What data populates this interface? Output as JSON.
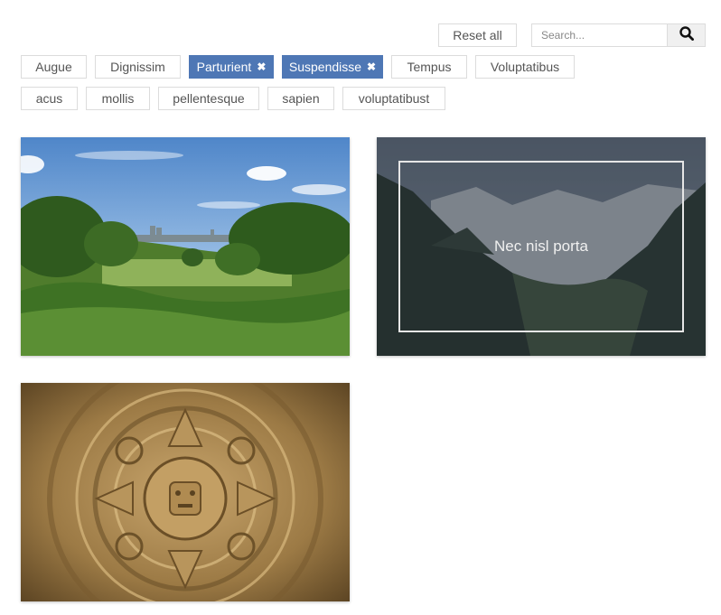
{
  "toolbar": {
    "reset_label": "Reset all",
    "search_placeholder": "Search..."
  },
  "filters": {
    "row1": [
      {
        "label": "Augue",
        "active": false
      },
      {
        "label": "Dignissim",
        "active": false
      },
      {
        "label": "Parturient",
        "active": true
      },
      {
        "label": "Suspendisse",
        "active": true
      },
      {
        "label": "Tempus",
        "active": false
      },
      {
        "label": "Voluptatibus",
        "active": false
      }
    ],
    "row2": [
      {
        "label": "acus",
        "active": false
      },
      {
        "label": "mollis",
        "active": false
      },
      {
        "label": "pellentesque",
        "active": false
      },
      {
        "label": "sapien",
        "active": false
      },
      {
        "label": "voluptatibust",
        "active": false
      }
    ],
    "remove_glyph": "✖"
  },
  "gallery": {
    "items": [
      {
        "caption": "",
        "image": "park-landscape"
      },
      {
        "caption": "Nec nisl porta",
        "image": "mountain-valley"
      },
      {
        "caption": "",
        "image": "aztec-sun-stone"
      }
    ]
  },
  "colors": {
    "active_tag": "#4e77b5",
    "border": "#dcdcdc"
  }
}
